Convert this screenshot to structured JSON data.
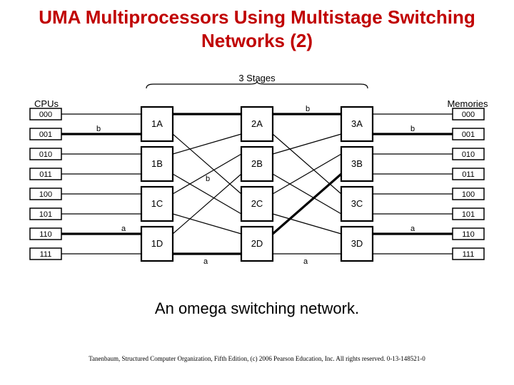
{
  "title_line1": "UMA Multiprocessors Using Multistage Switching",
  "title_line2": "Networks (2)",
  "caption": "An omega switching network.",
  "footer": "Tanenbaum, Structured Computer Organization, Fifth Edition, (c) 2006 Pearson Education, Inc. All rights reserved. 0-13-148521-0",
  "top_label": "3 Stages",
  "left_header": "CPUs",
  "right_header": "Memories",
  "ids": [
    "000",
    "001",
    "010",
    "011",
    "100",
    "101",
    "110",
    "111"
  ],
  "stage1": [
    "1A",
    "1B",
    "1C",
    "1D"
  ],
  "stage2": [
    "2A",
    "2B",
    "2C",
    "2D"
  ],
  "stage3": [
    "3A",
    "3B",
    "3C",
    "3D"
  ],
  "path_a_label": "a",
  "path_b_label": "b",
  "chart_data": {
    "type": "diagram",
    "network": "omega",
    "stages": 3,
    "switches_per_stage": 4,
    "inputs": 8,
    "outputs": 8,
    "input_labels": [
      "000",
      "001",
      "010",
      "011",
      "100",
      "101",
      "110",
      "111"
    ],
    "output_labels": [
      "000",
      "001",
      "010",
      "011",
      "100",
      "101",
      "110",
      "111"
    ],
    "stage_labels": [
      [
        "1A",
        "1B",
        "1C",
        "1D"
      ],
      [
        "2A",
        "2B",
        "2C",
        "2D"
      ],
      [
        "3A",
        "3B",
        "3C",
        "3D"
      ]
    ],
    "s12_map": [
      [
        0,
        0
      ],
      [
        1,
        4
      ],
      [
        2,
        1
      ],
      [
        3,
        5
      ],
      [
        4,
        2
      ],
      [
        5,
        6
      ],
      [
        6,
        3
      ],
      [
        7,
        7
      ]
    ],
    "s23_map": [
      [
        0,
        0
      ],
      [
        1,
        4
      ],
      [
        2,
        1
      ],
      [
        3,
        5
      ],
      [
        4,
        2
      ],
      [
        5,
        6
      ],
      [
        6,
        3
      ],
      [
        7,
        7
      ]
    ],
    "highlighted_paths": {
      "a": {
        "input": "110",
        "output": "110",
        "stages": [
          "1D",
          "2D",
          "3D"
        ]
      },
      "b": {
        "input": "001",
        "output": "001",
        "stages": [
          "1A",
          "2A",
          "3A"
        ]
      }
    }
  }
}
